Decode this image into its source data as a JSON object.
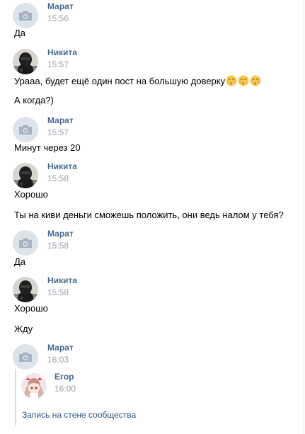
{
  "messages": [
    {
      "author": "Марат",
      "time": "15:56",
      "avatar": "camera-placeholder",
      "lines": [
        "Да"
      ]
    },
    {
      "author": "Никита",
      "time": "15:57",
      "avatar": "helmet-photo",
      "lines": [
        "Урааа, будет ещё один пост на большую доверку",
        "А когда?)"
      ],
      "emoji": [
        "😚",
        "😚",
        "😚"
      ]
    },
    {
      "author": "Марат",
      "time": "15:57",
      "avatar": "camera-placeholder",
      "lines": [
        "Минут через 20"
      ]
    },
    {
      "author": "Никита",
      "time": "15:58",
      "avatar": "helmet-photo",
      "lines": [
        "Хорошо",
        "Ты на киви деньги сможешь положить, они ведь налом у тебя?"
      ]
    },
    {
      "author": "Марат",
      "time": "15:58",
      "avatar": "camera-placeholder",
      "lines": [
        "Да"
      ]
    },
    {
      "author": "Никита",
      "time": "15:58",
      "avatar": "helmet-photo",
      "lines": [
        "Хорошо",
        "Жду"
      ]
    },
    {
      "author": "Марат",
      "time": "16:03",
      "avatar": "camera-placeholder",
      "lines": []
    }
  ],
  "forwarded": {
    "author": "Егор",
    "time": "16:00",
    "avatar": "anime-girl-photo",
    "attachment_label": "Запись на стене сообщества"
  },
  "colors": {
    "author_name": "#4a6b8f",
    "timestamp": "#9aa1a9",
    "link": "#2a5885",
    "placeholder_bg": "#dde3ea",
    "placeholder_icon": "#a6b3c3",
    "forward_bar": "#d7dde5"
  }
}
